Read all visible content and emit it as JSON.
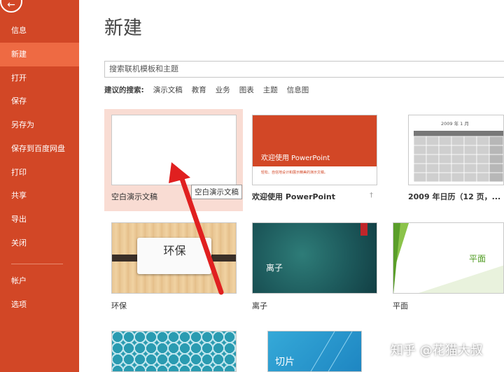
{
  "sidebar": {
    "items": [
      {
        "label": "信息"
      },
      {
        "label": "新建"
      },
      {
        "label": "打开"
      },
      {
        "label": "保存"
      },
      {
        "label": "另存为"
      },
      {
        "label": "保存到百度网盘"
      },
      {
        "label": "打印"
      },
      {
        "label": "共享"
      },
      {
        "label": "导出"
      },
      {
        "label": "关闭"
      },
      {
        "label": "帐户"
      },
      {
        "label": "选项"
      }
    ]
  },
  "main": {
    "title": "新建",
    "search_placeholder": "搜索联机模板和主题",
    "suggest_label": "建议的搜索:",
    "suggestions": [
      "演示文稿",
      "教育",
      "业务",
      "图表",
      "主题",
      "信息图"
    ]
  },
  "templates": [
    {
      "label": "空白演示文稿"
    },
    {
      "label": "欢迎使用 PowerPoint",
      "thumb_title": "欢迎使用 PowerPoint",
      "thumb_sub": "轻松、自信地设计和展示精美的演示文稿。"
    },
    {
      "label": "2009 年日历（12 页，...",
      "thumb_title": "2009 年 1 月"
    },
    {
      "label": "环保",
      "thumb_title": "环保"
    },
    {
      "label": "离子",
      "thumb_title": "离子"
    },
    {
      "label": "平面",
      "thumb_title": "平面"
    },
    {
      "label": ""
    },
    {
      "label": "",
      "thumb_title": "切片"
    }
  ],
  "tooltip": "空白演示文稿",
  "watermark": "知乎 @花猫大叔",
  "colors": {
    "sidebar": "#d24726",
    "active": "#ee6a43",
    "accent_arrow": "#e02020"
  }
}
